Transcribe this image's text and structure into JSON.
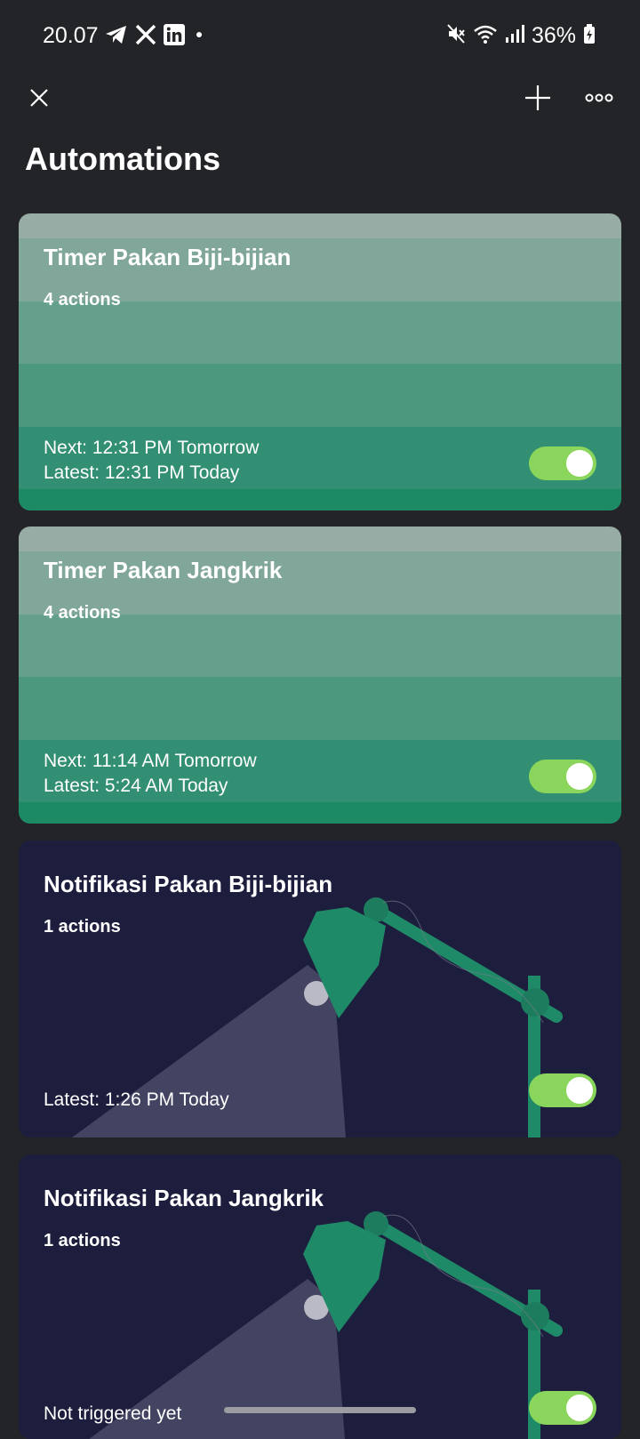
{
  "status_bar": {
    "time": "20.07",
    "battery_percent": "36%",
    "app_icons": [
      "telegram-icon",
      "x-icon",
      "linkedin-icon",
      "dot"
    ],
    "system_icons": [
      "mute-icon",
      "wifi-icon",
      "signal-icon",
      "battery-icon"
    ]
  },
  "header": {
    "close_icon": "close-icon",
    "add_icon": "plus-icon",
    "more_icon": "more-icon"
  },
  "page": {
    "title": "Automations"
  },
  "automations": [
    {
      "title": "Timer Pakan Biji-bijian",
      "actions": "4 actions",
      "next": "Next: 12:31 PM Tomorrow",
      "latest": "Latest: 12:31 PM Today",
      "enabled": true,
      "style": "green"
    },
    {
      "title": "Timer Pakan Jangkrik",
      "actions": "4 actions",
      "next": "Next: 11:14 AM Tomorrow",
      "latest": "Latest: 5:24 AM Today",
      "enabled": true,
      "style": "green"
    },
    {
      "title": "Notifikasi Pakan Biji-bijian",
      "actions": "1 actions",
      "latest": "Latest: 1:26 PM Today",
      "enabled": true,
      "style": "dark-lamp"
    },
    {
      "title": "Notifikasi Pakan Jangkrik",
      "actions": "1 actions",
      "latest": "Not triggered yet",
      "enabled": true,
      "style": "dark-lamp"
    }
  ],
  "colors": {
    "background": "#232428",
    "toggle_on": "#8ad55b",
    "dark_card": "#1d1e3d",
    "lamp_green": "#1f8a68"
  }
}
